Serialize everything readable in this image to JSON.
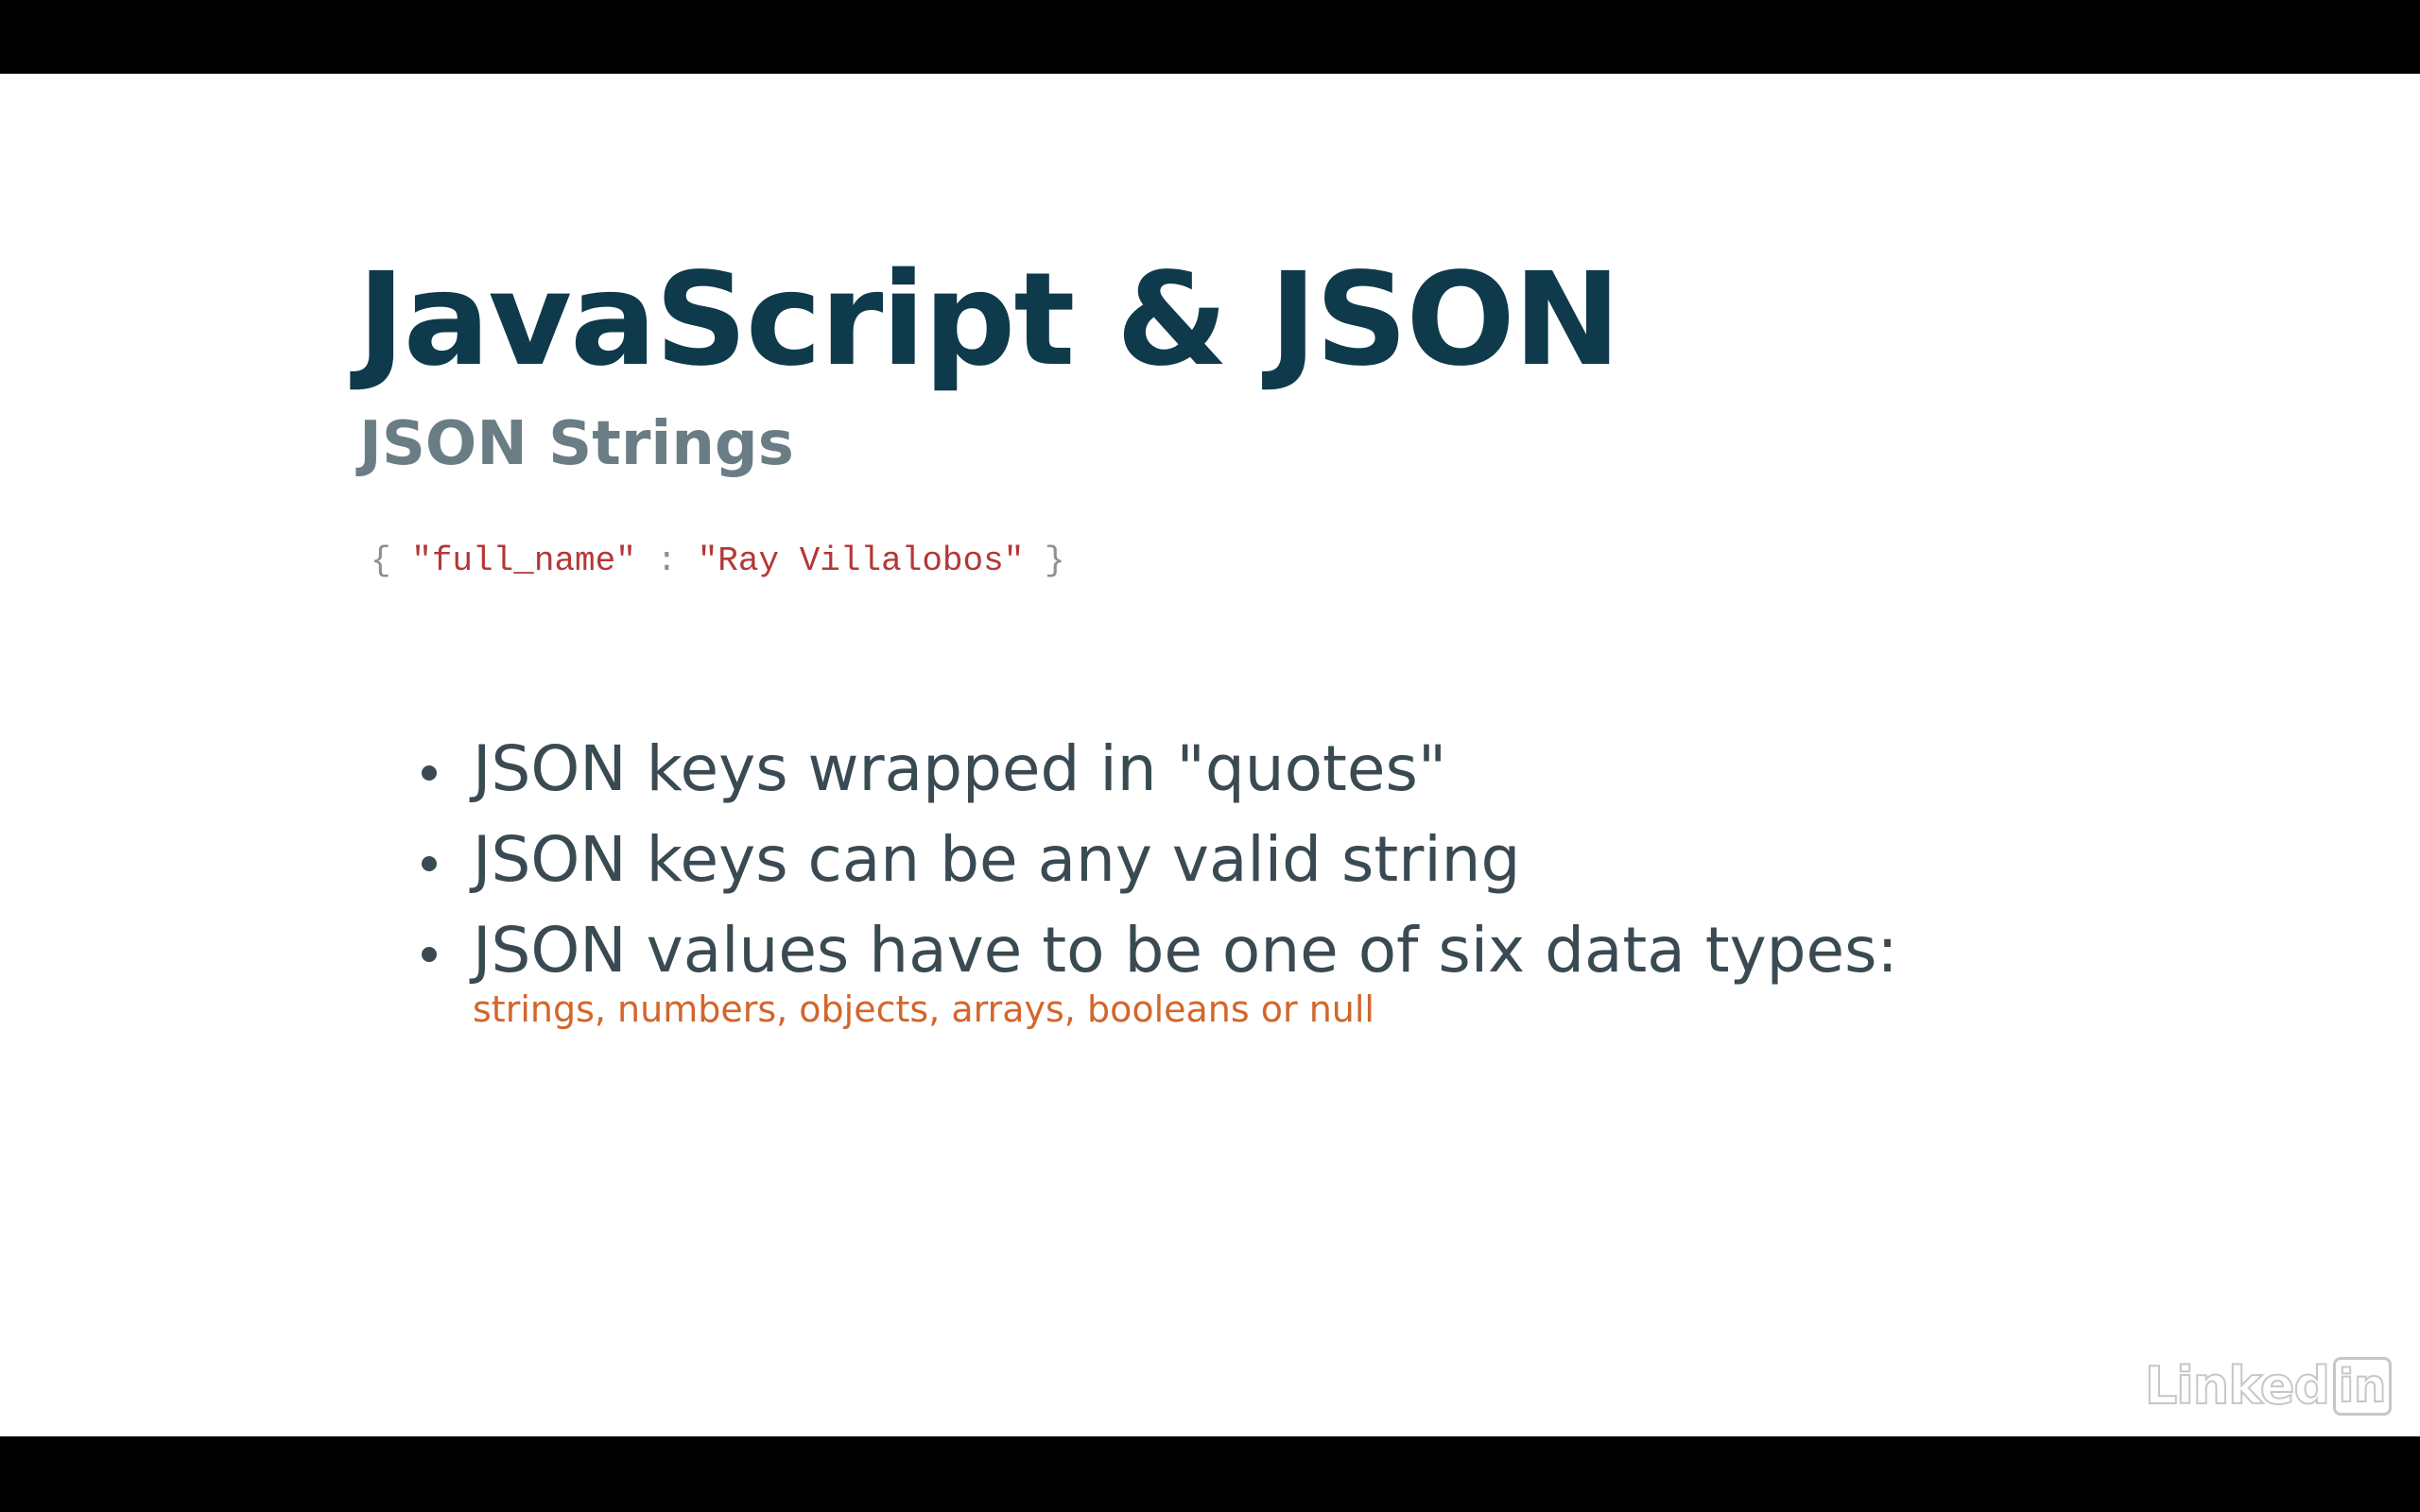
{
  "slide": {
    "title": "JavaScript & JSON",
    "subtitle": "JSON Strings",
    "code": {
      "open_brace": "{",
      "key": "\"full_name\"",
      "colon": ":",
      "value": "\"Ray Villalobos\"",
      "close_brace": "}"
    },
    "bullets": [
      {
        "text": "JSON keys wrapped in \"quotes\""
      },
      {
        "text": "JSON keys can be any valid string"
      },
      {
        "text": "JSON values have to be one of six data types:",
        "note": "strings, numbers, objects, arrays, booleans or null"
      }
    ]
  },
  "watermark": {
    "text": "Linked",
    "box": "in"
  },
  "colors": {
    "title": "#0e3a4c",
    "subtitle": "#6a7d85",
    "code_string": "#b53737",
    "bullet_text": "#3a4a52",
    "note_text": "#d2662b"
  }
}
